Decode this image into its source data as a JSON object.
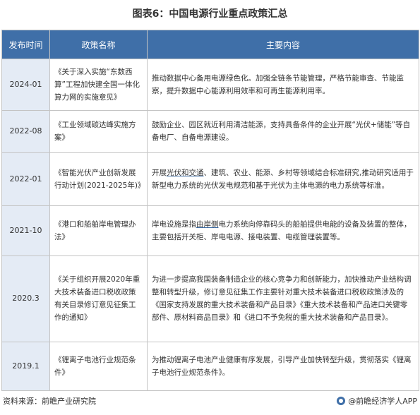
{
  "title": "图表6：中国电源行业重点政策汇总",
  "headers": {
    "date": "发布时间",
    "policy": "政策名称",
    "content": "主要内容"
  },
  "rows": [
    {
      "date": "2024-01",
      "policy": "《关于深入实施“东数西算”工程加快建全国一体化算力网的实施意见》",
      "content": "推动数据中心备用电源绿色化。加强全链条节能管理，严格节能审查、节能监察，提升数据中心能源利用效率和可再生能源利用率。"
    },
    {
      "date": "2022-08",
      "policy": "《工业领域碳达峰实施方案》",
      "content": "鼓励企业、园区就近利用清洁能源，支持具备条件的企业开展“光伏+储能”等自备电厂、自备电源建设。"
    },
    {
      "date": "2022-01",
      "policy": "《智能光伏产业创新发展行动计划(2021-2025年)》",
      "content_pre": "开展",
      "content_u": "光伏和交通",
      "content_post": "、建筑、农业、能源、乡村等领域结合标准研究,推动研究适用于新型电力系统的光伏发电规范和基于光伏为主体电源的电力系统等标准。"
    },
    {
      "date": "2021-10",
      "policy": "《港口和船舶岸电管理办法》",
      "content_pre": "岸电设施是指",
      "content_u": "由岸侧",
      "content_post": "电力系统向停靠码头的船舶提供电能的设备及装置的整体，主要包括开关柜、岸电电源、接电装置、电缆管理装置等。"
    },
    {
      "date": "2020.3",
      "policy": "《关于组织开展2020年重大技术装备进口税收政策有关目录修订意见征集工作的通知》",
      "content": "为进一步提高我国装备制造企业的核心竞争力和创新能力，加快推动产业结构调整和转型升级，修订意见征集工作主要针对重大技术装备进口税收政策涉及的《国家支持发展的重大技术装备和产品目录》《重大技术装备和产品进口关键零部件、原材料商品目录》和《进口不予免税的重大技术装备和产品目录》。"
    },
    {
      "date": "2019.1",
      "policy": "《锂离子电池行业规范条件》",
      "content": "为推动锂离子电池产业健康有序发展，引导产业加快转型升级，贯彻落实《锂离子电池行业规范条件》。"
    }
  ],
  "footer": {
    "source": "资料来源：前瞻产业研究院",
    "brand": "@前瞻经济学人APP"
  }
}
